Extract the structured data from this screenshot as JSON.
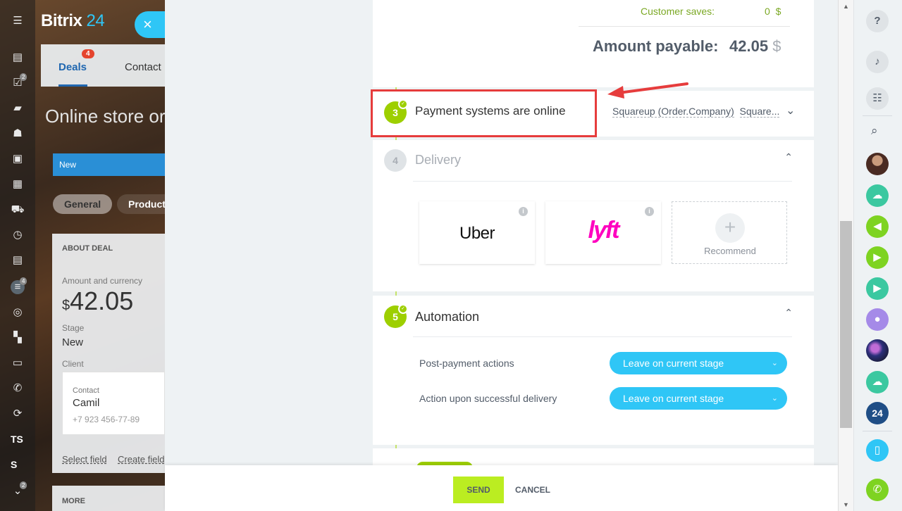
{
  "app": {
    "logo_text": "Bitrix",
    "logo_num": "24",
    "close_icon": "×",
    "tabs": {
      "deals": "Deals",
      "deals_badge": "4",
      "contacts": "Contact"
    },
    "heading": "Online store or",
    "stage_bar": "New",
    "pills": {
      "general": "General",
      "products": "Product"
    },
    "rail_badges": {
      "tasks": "2",
      "filter": "4",
      "more": "2"
    },
    "rail_text": {
      "ts": "TS",
      "s": "S"
    },
    "deal_card": {
      "about": "ABOUT DEAL",
      "amount_label": "Amount and currency",
      "amount_currency": "$",
      "amount_value": "42.05",
      "stage_label": "Stage",
      "stage_value": "New",
      "client_label": "Client",
      "contact_label": "Contact",
      "contact_name": "Camil",
      "contact_phone": "+7 923 456-77-89",
      "select_field": "Select field",
      "create_field": "Create field"
    },
    "more_label": "MORE"
  },
  "summary": {
    "saves_label": "Customer saves:",
    "saves_value": "0",
    "saves_currency": "$",
    "payable_label": "Amount payable:",
    "payable_value": "42.05",
    "payable_currency": "$"
  },
  "payment": {
    "step": "3",
    "title": "Payment systems are online",
    "systems_1": "Squareup (Order.Company)",
    "systems_2": "Square..."
  },
  "delivery": {
    "step": "4",
    "title": "Delivery",
    "tiles": {
      "uber": "Uber",
      "lyft": "lyft",
      "recommend": "Recommend"
    }
  },
  "automation": {
    "step": "5",
    "title": "Automation",
    "post_payment_label": "Post-payment actions",
    "post_payment_value": "Leave on current stage",
    "delivery_label": "Action upon successful delivery",
    "delivery_value": "Leave on current stage"
  },
  "footer": {
    "send": "SEND",
    "cancel": "CANCEL"
  },
  "colors": {
    "accent_green": "#9dcf00",
    "send_green": "#bbed21",
    "select_blue": "#2fc6f6",
    "highlight_red": "#e63c3c"
  }
}
